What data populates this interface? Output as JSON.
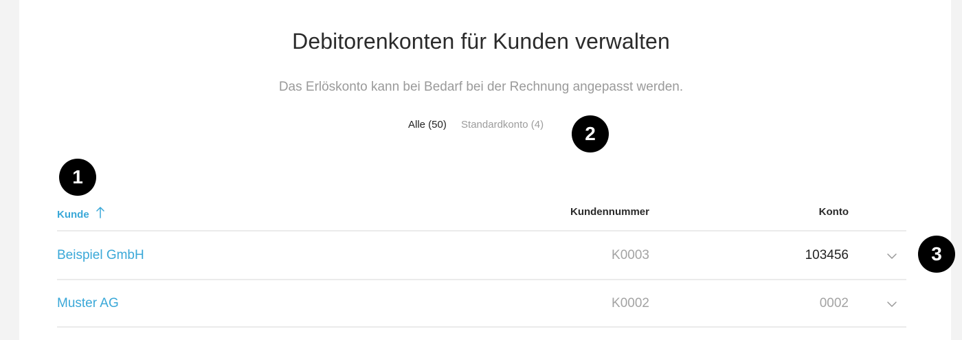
{
  "header": {
    "title": "Debitorenkonten für Kunden verwalten",
    "subtitle": "Das Erlöskonto kann bei Bedarf bei der Rechnung angepasst werden."
  },
  "tabs": [
    {
      "label": "Alle (50)",
      "active": true
    },
    {
      "label": "Standardkonto (4)",
      "active": false
    }
  ],
  "markers": [
    "1",
    "2",
    "3"
  ],
  "table": {
    "columns": {
      "kunde": "Kunde",
      "kundennummer": "Kundennummer",
      "konto": "Konto"
    },
    "sort_icon": "arrow-up-icon",
    "rows": [
      {
        "kunde": "Beispiel GmbH",
        "kundennummer": "K0003",
        "konto": "103456",
        "konto_is_default": false
      },
      {
        "kunde": "Muster AG",
        "kundennummer": "K0002",
        "konto": "0002",
        "konto_is_default": true
      }
    ]
  },
  "colors": {
    "accent": "#3aa8d8",
    "marker": "#000000",
    "muted_text": "#a3a3a3",
    "background": "#f3f3f3"
  }
}
